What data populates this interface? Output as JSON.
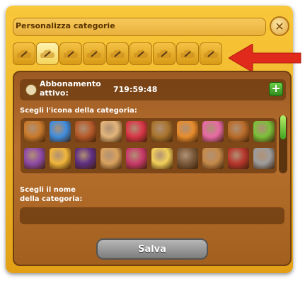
{
  "window": {
    "title": "Personalizza categorie"
  },
  "tabs": {
    "count": 9,
    "active_index": 1
  },
  "subscription": {
    "label": "Abbonamento attivo:",
    "timer": "719:59:48"
  },
  "icon_picker": {
    "label": "Scegli l'icona della categoria:",
    "icons": [
      [
        "crate-icon",
        "#c97a2c"
      ],
      [
        "diamond-icon",
        "#3f8ee0"
      ],
      [
        "flowerpot-icon",
        "#b55a2a"
      ],
      [
        "cone-icon",
        "#e2b57a"
      ],
      [
        "padlock-heart-icon",
        "#d93648"
      ],
      [
        "bread-tools-icon",
        "#a9742e"
      ],
      [
        "candy-icon",
        "#e88d2e"
      ],
      [
        "cupcake-icon",
        "#e86aa5"
      ],
      [
        "backpack-icon",
        "#b96c2a"
      ],
      [
        "battery-icon",
        "#7bc03a"
      ],
      [
        "flower-bunch-icon",
        "#8e4aa8"
      ],
      [
        "honey-jar-icon",
        "#f0b63c"
      ],
      [
        "witch-hat-icon",
        "#5e2f83"
      ],
      [
        "palette-icon",
        "#d9a25f"
      ],
      [
        "gift-icon",
        "#c83a6b"
      ],
      [
        "cheese-icon",
        "#f2d05a"
      ],
      [
        "hammer-icon",
        "#7a5a3a"
      ],
      [
        "box-icon",
        "#c58a4a"
      ],
      [
        "sausage-icon",
        "#b8362d"
      ],
      [
        "trowel-icon",
        "#9d9d9d"
      ]
    ]
  },
  "name_input": {
    "label_line1": "Scegli il nome",
    "label_line2": "della categoria:",
    "value": ""
  },
  "save_button": {
    "label": "Salva"
  },
  "colors": {
    "frame": "#f2b62b",
    "panel": "#a9662a",
    "arrow": "#e02a1b"
  }
}
